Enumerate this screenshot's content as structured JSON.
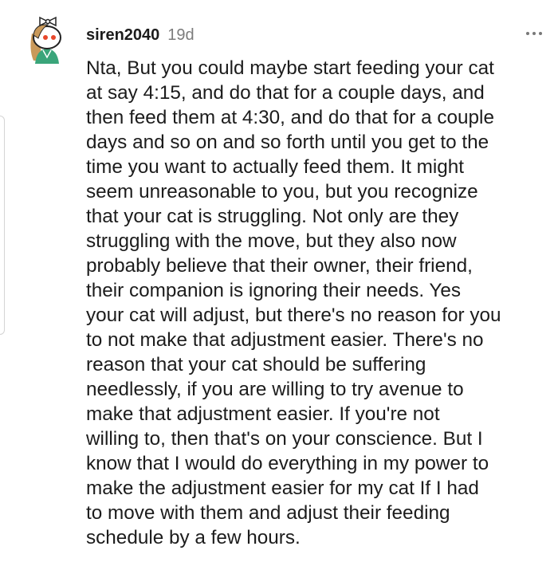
{
  "comment": {
    "username": "siren2040",
    "age": "19d",
    "body_lines": [
      "Nta, But you could maybe start feeding your cat",
      "at say 4:15, and do that for a couple days, and",
      "then feed them at 4:30, and do that for a couple",
      "days and so on and so forth until you get to the",
      "time you want to actually feed them. It might",
      "seem unreasonable to you, but you recognize",
      "that your cat is struggling. Not only are they",
      "struggling with the move, but they also now",
      "probably believe that their owner, their friend,",
      "their companion is ignoring their needs. Yes",
      "your cat will adjust, but there's no reason for you",
      "to not make that adjustment easier. There's no",
      "reason that your cat should be suffering",
      "needlessly, if you are willing to try avenue to",
      "make that adjustment easier. If you're not",
      "willing to, then that's on your conscience. But I",
      "know that I would do everything in my power to",
      "make the adjustment easier for my cat If I had",
      "to move with them and adjust their feeding",
      "schedule by a few hours."
    ]
  },
  "icons": {
    "avatar": "snoo-avatar-icon",
    "more": "more-options-icon"
  },
  "colors": {
    "text": "#1c1c1c",
    "meta": "#7c7c7c",
    "avatar_shirt": "#3aa57a",
    "avatar_hair": "#c9995a"
  }
}
